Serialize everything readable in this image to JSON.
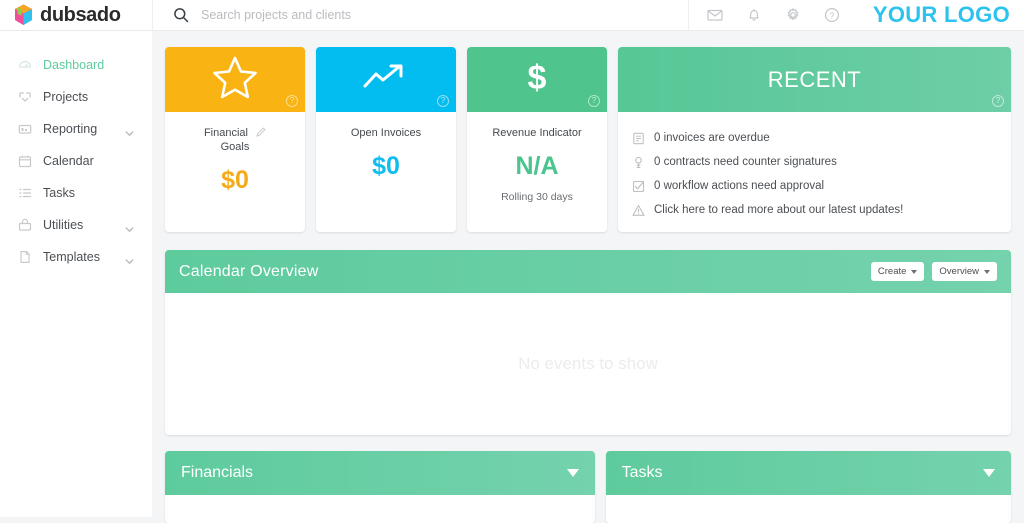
{
  "brand": {
    "name": "dubsado",
    "logo_icon": "cube-logo-icon"
  },
  "search": {
    "placeholder": "Search projects and clients",
    "value": "",
    "icon": "search-icon"
  },
  "top_actions": {
    "mail_icon": "envelope-icon",
    "bell_icon": "bell-icon",
    "gear_icon": "gear-icon",
    "help_icon": "question-circle-icon",
    "account_logo": "YOUR LOGO",
    "account_logo_color": "#2ec2ef"
  },
  "sidebar": {
    "items": [
      {
        "label": "Dashboard",
        "icon": "dashboard-icon",
        "active": true,
        "caret": false
      },
      {
        "label": "Projects",
        "icon": "projects-icon",
        "active": false,
        "caret": false
      },
      {
        "label": "Reporting",
        "icon": "reporting-icon",
        "active": false,
        "caret": true
      },
      {
        "label": "Calendar",
        "icon": "calendar-icon",
        "active": false,
        "caret": false
      },
      {
        "label": "Tasks",
        "icon": "tasks-icon",
        "active": false,
        "caret": false
      },
      {
        "label": "Utilities",
        "icon": "utilities-icon",
        "active": false,
        "caret": true
      },
      {
        "label": "Templates",
        "icon": "templates-icon",
        "active": false,
        "caret": true
      }
    ],
    "active_color": "#5ecb9d"
  },
  "metrics": [
    {
      "title": "Financial\nGoals",
      "title_line1": "Financial",
      "title_line2": "Goals",
      "value": "$0",
      "sub": "",
      "icon": "star-icon",
      "header_color": "#f9b312",
      "value_color": "#f5ab18",
      "help": "?",
      "editable": true
    },
    {
      "title_line1": "Open Invoices",
      "title_line2": "",
      "value": "$0",
      "sub": "",
      "icon": "trend-up-icon",
      "header_color": "#04bdf0",
      "value_color": "#10bdef",
      "help": "?",
      "editable": false
    },
    {
      "title_line1": "Revenue Indicator",
      "title_line2": "",
      "value": "N/A",
      "sub": "Rolling 30 days",
      "icon": "dollar-icon",
      "header_color": "#4fc48d",
      "value_color": "#4cc48d",
      "help": "?",
      "editable": false
    }
  ],
  "recent": {
    "title": "RECENT",
    "help": "?",
    "items": [
      {
        "text": "0 invoices are overdue",
        "icon": "invoice-icon"
      },
      {
        "text": "0 contracts need counter signatures",
        "icon": "signature-icon"
      },
      {
        "text": "0 workflow actions need approval",
        "icon": "checkbox-icon"
      },
      {
        "text": "Click here to read more about our latest updates!",
        "icon": "warning-icon"
      }
    ]
  },
  "calendar": {
    "title": "Calendar Overview",
    "create_label": "Create",
    "overview_label": "Overview",
    "empty_text": "No events to show"
  },
  "bottom": {
    "financials_title": "Financials",
    "tasks_title": "Tasks",
    "collapse_icon": "chevron-down-icon"
  },
  "theme": {
    "green": "#5ecb9d",
    "gold": "#f9b312",
    "cyan": "#04bdf0",
    "page_bg": "#f4f5f6"
  }
}
